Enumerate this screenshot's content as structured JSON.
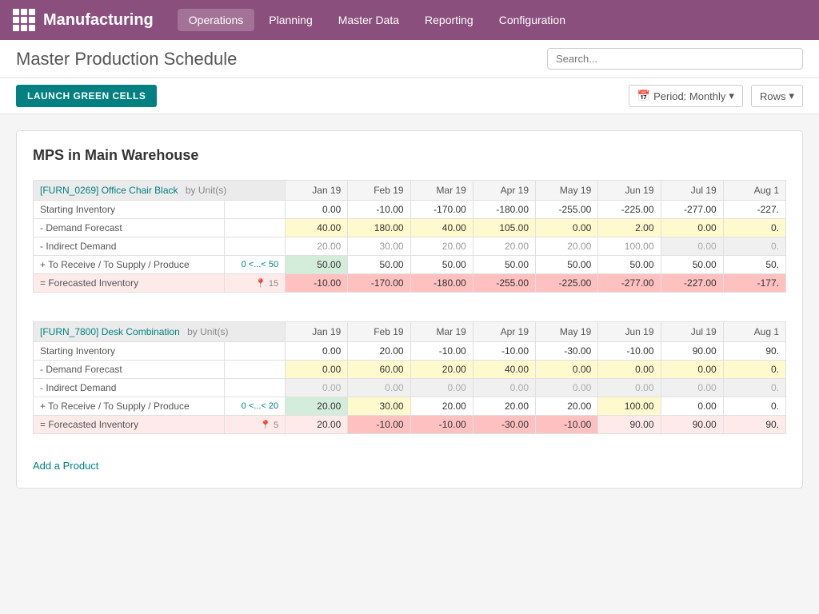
{
  "app": {
    "name": "Manufacturing",
    "nav_items": [
      "Operations",
      "Planning",
      "Master Data",
      "Reporting",
      "Configuration"
    ],
    "active_nav": "Operations"
  },
  "header": {
    "title": "Master Production Schedule",
    "search_placeholder": "Search..."
  },
  "toolbar": {
    "launch_btn": "LAUNCH GREEN CELLS",
    "period_label": "Period: Monthly",
    "rows_label": "Rows"
  },
  "main": {
    "section_title": "MPS in Main Warehouse",
    "products": [
      {
        "id": "product-1",
        "code": "[FURN_0269] Office Chair Black",
        "unit": "by Unit(s)",
        "range_label": "0 <...< 50",
        "pin_label": "15",
        "months": [
          "Jan 19",
          "Feb 19",
          "Mar 19",
          "Apr 19",
          "May 19",
          "Jun 19",
          "Jul 19",
          "Aug 1"
        ],
        "rows": [
          {
            "label": "Starting Inventory",
            "type": "starting",
            "values": [
              "0.00",
              "-10.00",
              "-170.00",
              "-180.00",
              "-255.00",
              "-225.00",
              "-277.00",
              "-227."
            ]
          },
          {
            "label": "- Demand Forecast",
            "type": "demand",
            "values": [
              "40.00",
              "180.00",
              "40.00",
              "105.00",
              "0.00",
              "2.00",
              "0.00",
              "0."
            ],
            "highlights": [
              "yellow",
              "yellow",
              "yellow",
              "yellow",
              "yellow",
              "yellow",
              "yellow",
              "yellow"
            ]
          },
          {
            "label": "- Indirect Demand",
            "type": "indirect",
            "values": [
              "20.00",
              "30.00",
              "20.00",
              "20.00",
              "20.00",
              "100.00",
              "0.00",
              "0."
            ]
          },
          {
            "label": "+ To Receive / To Supply / Produce",
            "type": "receive",
            "values": [
              "50.00",
              "50.00",
              "50.00",
              "50.00",
              "50.00",
              "50.00",
              "50.00",
              "50."
            ],
            "highlights": [
              "green",
              "",
              "",
              "",
              "",
              "",
              "",
              ""
            ]
          },
          {
            "label": "= Forecasted Inventory",
            "type": "forecasted",
            "values": [
              "-10.00",
              "-170.00",
              "-180.00",
              "-255.00",
              "-225.00",
              "-277.00",
              "-227.00",
              "-177."
            ]
          }
        ]
      },
      {
        "id": "product-2",
        "code": "[FURN_7800] Desk Combination",
        "unit": "by Unit(s)",
        "range_label": "0 <...< 20",
        "pin_label": "5",
        "months": [
          "Jan 19",
          "Feb 19",
          "Mar 19",
          "Apr 19",
          "May 19",
          "Jun 19",
          "Jul 19",
          "Aug 1"
        ],
        "rows": [
          {
            "label": "Starting Inventory",
            "type": "starting",
            "values": [
              "0.00",
              "20.00",
              "-10.00",
              "-10.00",
              "-30.00",
              "-10.00",
              "90.00",
              "90."
            ]
          },
          {
            "label": "- Demand Forecast",
            "type": "demand",
            "values": [
              "0.00",
              "60.00",
              "20.00",
              "40.00",
              "0.00",
              "0.00",
              "0.00",
              "0."
            ],
            "highlights": [
              "yellow",
              "yellow",
              "yellow",
              "yellow",
              "yellow",
              "yellow",
              "yellow",
              "yellow"
            ]
          },
          {
            "label": "- Indirect Demand",
            "type": "indirect",
            "values": [
              "0.00",
              "0.00",
              "0.00",
              "0.00",
              "0.00",
              "0.00",
              "0.00",
              "0."
            ]
          },
          {
            "label": "+ To Receive / To Supply / Produce",
            "type": "receive",
            "values": [
              "20.00",
              "30.00",
              "20.00",
              "20.00",
              "20.00",
              "100.00",
              "0.00",
              "0."
            ],
            "highlights": [
              "green",
              "yellow",
              "",
              "",
              "",
              "yellow",
              "",
              ""
            ]
          },
          {
            "label": "= Forecasted Inventory",
            "type": "forecasted",
            "values": [
              "20.00",
              "-10.00",
              "-10.00",
              "-30.00",
              "-10.00",
              "90.00",
              "90.00",
              "90."
            ]
          }
        ]
      }
    ],
    "add_product_label": "Add a Product"
  }
}
